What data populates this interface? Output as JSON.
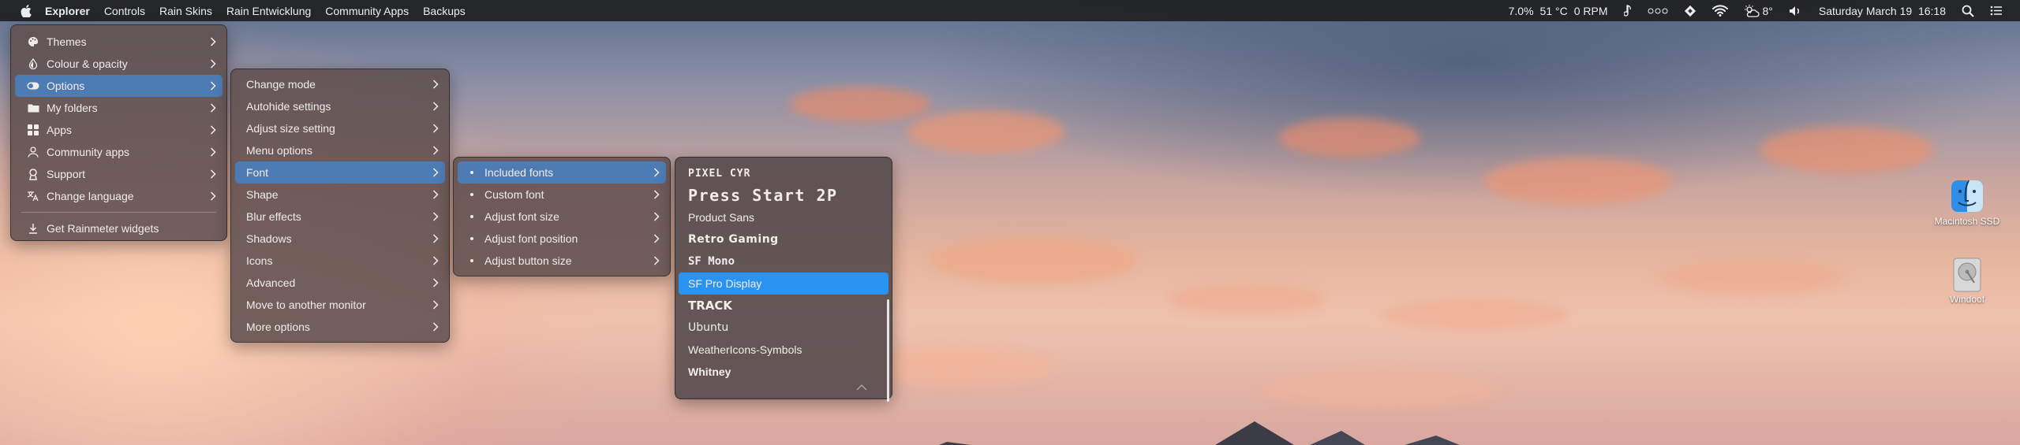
{
  "menubar": {
    "app_name": "Explorer",
    "items": [
      "Controls",
      "Rain Skins",
      "Rain Entwicklung",
      "Community Apps",
      "Backups"
    ],
    "status": {
      "cpu": "7.0%",
      "temp": "51 °C",
      "fan": "0 RPM",
      "weather": "8°",
      "datetime": "Saturday March 19  16:18"
    }
  },
  "main_menu": {
    "items": [
      {
        "label": "Themes",
        "icon": "palette-icon"
      },
      {
        "label": "Colour & opacity",
        "icon": "drop-icon"
      },
      {
        "label": "Options",
        "icon": "toggle-icon"
      },
      {
        "label": "My folders",
        "icon": "folder-icon"
      },
      {
        "label": "Apps",
        "icon": "grid-icon"
      },
      {
        "label": "Community apps",
        "icon": "person-icon"
      },
      {
        "label": "Support",
        "icon": "support-icon"
      },
      {
        "label": "Change language",
        "icon": "translate-icon"
      }
    ],
    "footer": {
      "label": "Get Rainmeter widgets",
      "icon": "download-icon"
    }
  },
  "options_menu": {
    "items": [
      "Change mode",
      "Autohide settings",
      "Adjust size setting",
      "Menu options",
      "Font",
      "Shape",
      "Blur effects",
      "Shadows",
      "Icons",
      "Advanced",
      "Move to another monitor",
      "More options"
    ]
  },
  "font_menu": {
    "items": [
      "Included fonts",
      "Custom font",
      "Adjust font size",
      "Adjust font position",
      "Adjust button size"
    ]
  },
  "included_fonts": {
    "items": [
      "PIXEL CYR",
      "Press Start 2P",
      "Product Sans",
      "Retro Gaming",
      "SF Mono",
      "SF Pro Display",
      "TRACK",
      "Ubuntu",
      "WeatherIcons-Symbols",
      "Whitney"
    ],
    "selected": "SF Pro Display"
  },
  "desktop": {
    "icons": [
      {
        "label": "Macintosh SSD",
        "icon": "finder-icon"
      },
      {
        "label": "Windoof",
        "icon": "drive-icon"
      }
    ]
  },
  "colors": {
    "selection_blue": "#4d7bb3",
    "font_selection": "#2a93f2"
  }
}
